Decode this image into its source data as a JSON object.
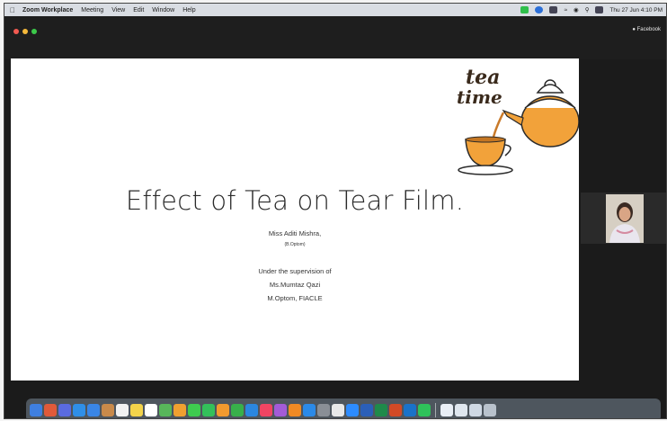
{
  "menubar": {
    "app_name": "Zoom Workplace",
    "items": [
      "Meeting",
      "View",
      "Edit",
      "Window",
      "Help"
    ],
    "clock": "Thu 27 Jun 4:10 PM"
  },
  "window": {
    "view_label": "Facebook"
  },
  "slide": {
    "title": "Effect of Tea on Tear Film.",
    "presenter": "Miss Aditi Mishra,",
    "degree": "(B.Optom)",
    "supervision": "Under the supervision of",
    "supervisor": "Ms.Mumtaz Qazi",
    "supervisor_degree": "M.Optom, FIACLE",
    "art_word1": "tea",
    "art_word2": "time"
  },
  "dock": {
    "apps": [
      {
        "name": "finder",
        "color": "#3f7fe0"
      },
      {
        "name": "launchpad",
        "color": "#e05a3a"
      },
      {
        "name": "calculator",
        "color": "#5a6be0"
      },
      {
        "name": "safari",
        "color": "#2f8fe8"
      },
      {
        "name": "mail",
        "color": "#3a86e6"
      },
      {
        "name": "contacts",
        "color": "#c98a4a"
      },
      {
        "name": "calendar",
        "color": "#f2f2f2"
      },
      {
        "name": "notes",
        "color": "#f3d34a"
      },
      {
        "name": "reminders",
        "color": "#ffffff"
      },
      {
        "name": "maps",
        "color": "#58b65a"
      },
      {
        "name": "photos",
        "color": "#f0a030"
      },
      {
        "name": "messages",
        "color": "#3ecb4f"
      },
      {
        "name": "facetime",
        "color": "#33c05a"
      },
      {
        "name": "pages",
        "color": "#f29a2e"
      },
      {
        "name": "numbers",
        "color": "#38b04a"
      },
      {
        "name": "keynote",
        "color": "#2b87e0"
      },
      {
        "name": "music",
        "color": "#f04563"
      },
      {
        "name": "podcasts",
        "color": "#a35bd8"
      },
      {
        "name": "books",
        "color": "#f08a24"
      },
      {
        "name": "app-store",
        "color": "#2b8ae8"
      },
      {
        "name": "settings",
        "color": "#8a8f96"
      },
      {
        "name": "chrome",
        "color": "#e8e8e8"
      },
      {
        "name": "zoom",
        "color": "#2d8cff"
      },
      {
        "name": "word",
        "color": "#2b5fb8"
      },
      {
        "name": "excel",
        "color": "#1f8a4a"
      },
      {
        "name": "powerpoint",
        "color": "#d24a26"
      },
      {
        "name": "outlook",
        "color": "#1a72c8"
      },
      {
        "name": "whatsapp",
        "color": "#2fc25a"
      },
      {
        "name": "document-1",
        "color": "#e9eef5"
      },
      {
        "name": "document-2",
        "color": "#dfe6ee"
      },
      {
        "name": "document-3",
        "color": "#cfd8e3"
      },
      {
        "name": "trash",
        "color": "#b9c2cc"
      }
    ]
  }
}
